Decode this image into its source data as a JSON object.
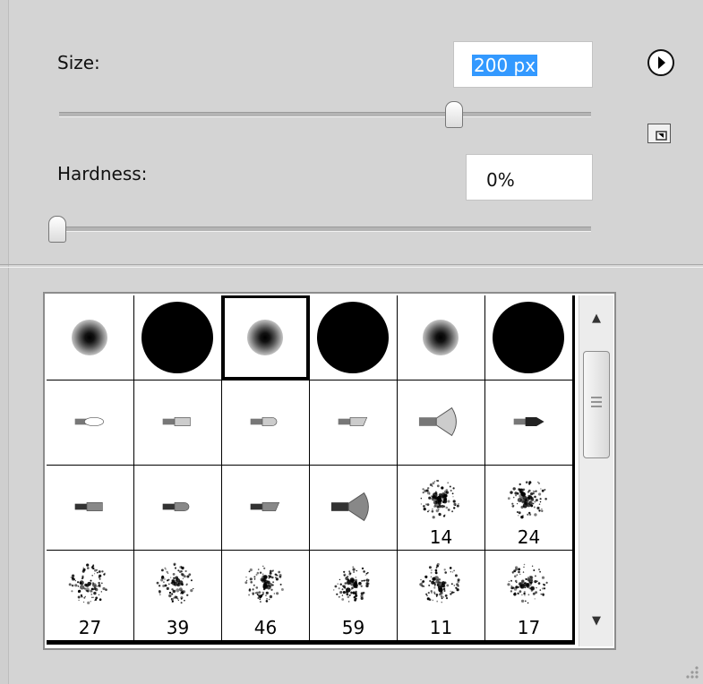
{
  "size": {
    "label": "Size:",
    "value": "200 px",
    "slider_fraction": 0.75
  },
  "hardness": {
    "label": "Hardness:",
    "value": "0%",
    "slider_fraction": 0.0
  },
  "icons": {
    "flyout": "flyout-arrow-icon",
    "new_preset": "new-preset-icon"
  },
  "presets": [
    {
      "kind": "soft",
      "label": ""
    },
    {
      "kind": "hard",
      "label": ""
    },
    {
      "kind": "soft",
      "label": "",
      "selected": true
    },
    {
      "kind": "hard",
      "label": ""
    },
    {
      "kind": "soft",
      "label": ""
    },
    {
      "kind": "hard",
      "label": ""
    },
    {
      "kind": "tip-round-point",
      "label": ""
    },
    {
      "kind": "tip-flat",
      "label": ""
    },
    {
      "kind": "tip-round",
      "label": ""
    },
    {
      "kind": "tip-angle",
      "label": ""
    },
    {
      "kind": "tip-fan",
      "label": ""
    },
    {
      "kind": "tip-bullet",
      "label": ""
    },
    {
      "kind": "tip-flat-dark",
      "label": ""
    },
    {
      "kind": "tip-round-dark",
      "label": ""
    },
    {
      "kind": "tip-angle-dark",
      "label": ""
    },
    {
      "kind": "tip-fan-dark",
      "label": ""
    },
    {
      "kind": "splatter",
      "label": "14"
    },
    {
      "kind": "splatter",
      "label": "24"
    },
    {
      "kind": "splatter",
      "label": "27"
    },
    {
      "kind": "splatter",
      "label": "39"
    },
    {
      "kind": "splatter",
      "label": "46"
    },
    {
      "kind": "splatter",
      "label": "59"
    },
    {
      "kind": "splatter",
      "label": "11"
    },
    {
      "kind": "splatter",
      "label": "17"
    }
  ]
}
